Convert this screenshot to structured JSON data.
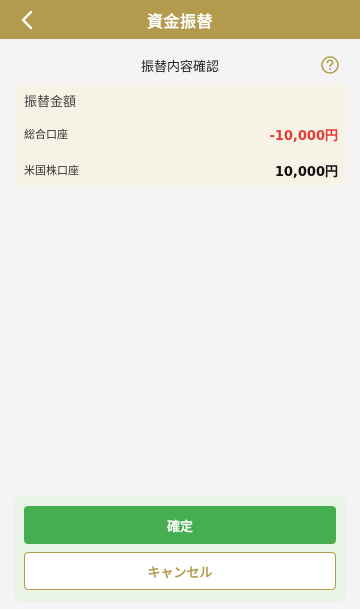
{
  "header": {
    "title": "資金振替",
    "back_icon": "chevron-left-icon"
  },
  "section": {
    "title": "振替内容確認",
    "help_icon": "question-circle-icon"
  },
  "transfer": {
    "heading": "振替金額",
    "rows": [
      {
        "label": "総合口座",
        "amount": "-10,000円"
      },
      {
        "label": "米国株口座",
        "amount": "10,000円"
      }
    ]
  },
  "actions": {
    "confirm_label": "確定",
    "cancel_label": "キャンセル"
  },
  "colors": {
    "brand_gold": "#b49a4c",
    "confirm_green": "#46ad51",
    "negative_red": "#e53935",
    "card_bg": "#f6f2e5",
    "panel_bg": "#e9f3e6"
  }
}
